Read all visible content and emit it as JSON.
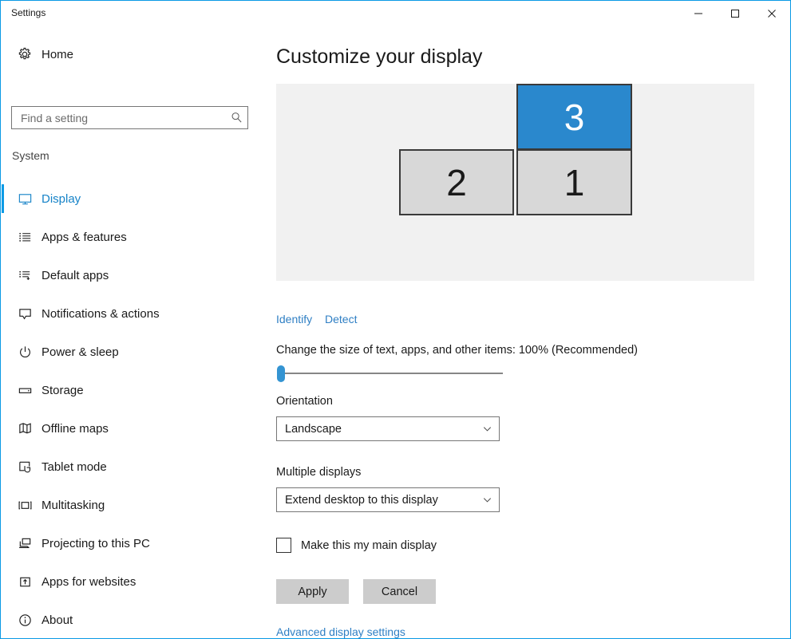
{
  "window": {
    "title": "Settings",
    "controls": {
      "minimize": "minimize-icon",
      "maximize": "maximize-icon",
      "close": "close-icon"
    },
    "border_color": "#0a9ae5"
  },
  "sidebar": {
    "home": {
      "label": "Home",
      "icon": "gear-icon"
    },
    "search": {
      "value": "",
      "placeholder": "Find a setting",
      "icon": "search-icon"
    },
    "section_title": "System",
    "items": [
      {
        "label": "Display",
        "icon": "monitor-icon",
        "selected": true
      },
      {
        "label": "Apps & features",
        "icon": "list-icon",
        "selected": false
      },
      {
        "label": "Default apps",
        "icon": "list-arrow-icon",
        "selected": false
      },
      {
        "label": "Notifications & actions",
        "icon": "speech-bubble-icon",
        "selected": false
      },
      {
        "label": "Power & sleep",
        "icon": "power-icon",
        "selected": false
      },
      {
        "label": "Storage",
        "icon": "drive-icon",
        "selected": false
      },
      {
        "label": "Offline maps",
        "icon": "map-icon",
        "selected": false
      },
      {
        "label": "Tablet mode",
        "icon": "tablet-touch-icon",
        "selected": false
      },
      {
        "label": "Multitasking",
        "icon": "multitask-icon",
        "selected": false
      },
      {
        "label": "Projecting to this PC",
        "icon": "project-screen-icon",
        "selected": false
      },
      {
        "label": "Apps for websites",
        "icon": "app-link-icon",
        "selected": false
      },
      {
        "label": "About",
        "icon": "info-icon",
        "selected": false
      }
    ],
    "accent_color": "#0a9ae5",
    "selected_text_color": "#1683c8"
  },
  "main": {
    "page_title": "Customize your display",
    "preview": {
      "background_color": "#f1f1f1",
      "monitors": [
        {
          "number": "3",
          "selected": true,
          "color": "#2a88cd"
        },
        {
          "number": "2",
          "selected": false,
          "color": "#d8d8d8"
        },
        {
          "number": "1",
          "selected": false,
          "color": "#d8d8d8"
        }
      ]
    },
    "links": {
      "identify": "Identify",
      "detect": "Detect",
      "advanced": "Advanced display settings",
      "color": "#2f7fc4"
    },
    "scaling": {
      "label": "Change the size of text, apps, and other items: 100% (Recommended)",
      "value_percent": "100%",
      "slider_position": "min",
      "thumb_color": "#3494d2"
    },
    "orientation": {
      "label": "Orientation",
      "value": "Landscape",
      "arrow_icon": "chevron-down-icon"
    },
    "multiple_displays": {
      "label": "Multiple displays",
      "value": "Extend desktop to this display",
      "arrow_icon": "chevron-down-icon"
    },
    "main_display_checkbox": {
      "label": "Make this my main display",
      "checked": false
    },
    "buttons": {
      "apply": "Apply",
      "cancel": "Cancel",
      "background_color": "#cccccc"
    }
  }
}
